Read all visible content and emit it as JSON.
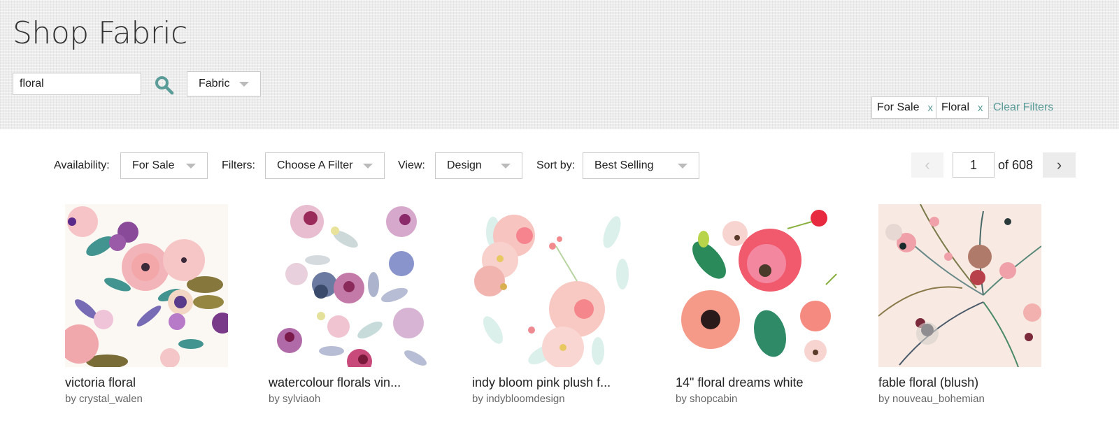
{
  "header": {
    "title": "Shop Fabric",
    "search": {
      "value": "floral",
      "icon": "search-icon"
    },
    "product_type_select": {
      "selected": "Fabric"
    },
    "active_filters": [
      {
        "label": "For Sale",
        "remove": "x"
      },
      {
        "label": "Floral",
        "remove": "x"
      }
    ],
    "clear_filters_label": "Clear Filters"
  },
  "toolbar": {
    "availability": {
      "label": "Availability:",
      "selected": "For Sale"
    },
    "filters": {
      "label": "Filters:",
      "selected": "Choose A Filter"
    },
    "view": {
      "label": "View:",
      "selected": "Design"
    },
    "sort": {
      "label": "Sort by:",
      "selected": "Best Selling"
    },
    "pagination": {
      "prev_icon": "‹",
      "current_page": "1",
      "of_label": "of 608",
      "next_icon": "›"
    }
  },
  "colors": {
    "accent": "#5a9c98",
    "border": "#c9c9c9",
    "header_bg": "#ededed"
  },
  "products": [
    {
      "name": "victoria floral",
      "designer": "by crystal_walen",
      "image": "pink roses, purple blooms, teal leaves on cream"
    },
    {
      "name": "watercolour florals vin...",
      "designer": "by sylviaoh",
      "image": "muted purple and blue watercolor florals on white"
    },
    {
      "name": "indy bloom pink plush f...",
      "designer": "by indybloomdesign",
      "image": "pink peony bouquet over mint leaves"
    },
    {
      "name": "14\" floral dreams white",
      "designer": "by shopcabin",
      "image": "coral and red watercolor flowers with green leaves"
    },
    {
      "name": "fable floral (blush)",
      "designer": "by nouveau_bohemian",
      "image": "dense folk floral on blush background"
    }
  ]
}
